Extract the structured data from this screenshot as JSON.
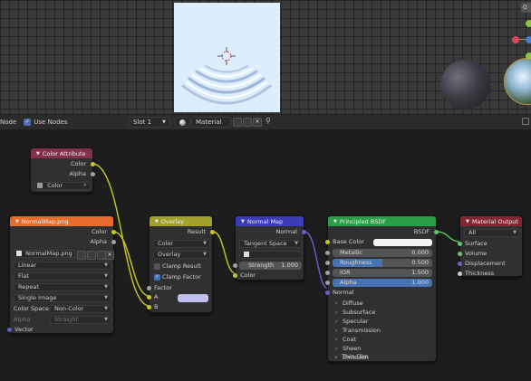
{
  "header": {
    "editor_label": "Node",
    "use_nodes_label": "Use Nodes",
    "slot": "Slot 1",
    "material": "Material"
  },
  "viewport": {
    "corner_chip": "O"
  },
  "nodes": {
    "color_attribute": {
      "title": "Color Attribute",
      "out_color": "Color",
      "out_alpha": "Alpha",
      "attribute_value": "Color"
    },
    "image_texture": {
      "title": "NormalMap.png",
      "out_color": "Color",
      "out_alpha": "Alpha",
      "image_name": "NormalMap.png",
      "interpolation": "Linear",
      "projection": "Flat",
      "extension": "Repeat",
      "source": "Single Image",
      "color_space_label": "Color Space",
      "color_space": "Non-Color",
      "alpha_label": "Alpha",
      "alpha_mode": "Straight",
      "in_vector": "Vector"
    },
    "overlay": {
      "title": "Overlay",
      "out_result": "Result",
      "data_type": "Color",
      "blend_mode": "Overlay",
      "clamp_result": "Clamp Result",
      "clamp_factor": "Clamp Factor",
      "in_factor": "Factor",
      "in_a": "A",
      "in_b": "B",
      "a_color": "#c0c0f0"
    },
    "normal_map": {
      "title": "Normal Map",
      "out_normal": "Normal",
      "space": "Tangent Space",
      "strength_label": "Strength",
      "strength_value": "1.000",
      "in_color": "Color"
    },
    "principled": {
      "title": "Principled BSDF",
      "out_bsdf": "BSDF",
      "base_color_label": "Base Color",
      "metallic_label": "Metallic",
      "metallic_value": "0.000",
      "roughness_label": "Roughness",
      "roughness_value": "0.500",
      "ior_label": "IOR",
      "ior_value": "1.500",
      "alpha_label": "Alpha",
      "alpha_value": "1.000",
      "in_normal": "Normal",
      "panels": [
        "Diffuse",
        "Subsurface",
        "Specular",
        "Transmission",
        "Coat",
        "Sheen",
        "Emission",
        "Thin Film"
      ]
    },
    "material_output": {
      "title": "Material Output",
      "target": "All",
      "in_surface": "Surface",
      "in_volume": "Volume",
      "in_displacement": "Displacement",
      "in_thickness": "Thickness"
    }
  },
  "colors": {
    "header_attribute": "#83314a",
    "header_texture": "#e86d2c",
    "header_color": "#a1a12c",
    "header_vector": "#3c3cb4",
    "header_shader": "#2b9c47",
    "header_output": "#832633",
    "socket_color": "#c7c729",
    "socket_float": "#a1a1a1",
    "socket_vector": "#6363c7",
    "socket_shader": "#63c763",
    "selection": "#4772b3"
  }
}
